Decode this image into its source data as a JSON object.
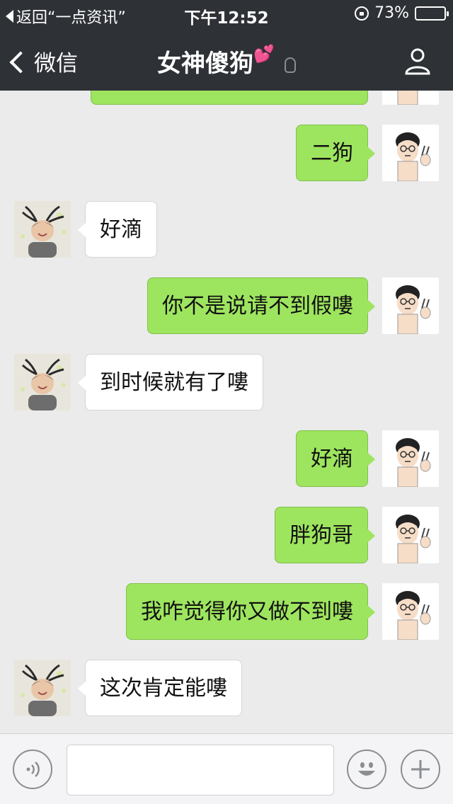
{
  "status_bar": {
    "back_app": "返回“一点资讯”",
    "time": "下午12:52",
    "battery_percent": "73%",
    "battery_level": 0.73,
    "battery_color": "#f5c400"
  },
  "nav": {
    "back_label": "微信",
    "title": "女神傻狗",
    "title_emoji": "💕",
    "ear_icon": "ear-icon",
    "profile_icon": "person-icon"
  },
  "messages": [
    {
      "side": "me",
      "text": "二狗"
    },
    {
      "side": "other",
      "text": "好滴"
    },
    {
      "side": "me",
      "text": "你不是说请不到假嘍"
    },
    {
      "side": "other",
      "text": "到时候就有了嘍"
    },
    {
      "side": "me",
      "text": "好滴"
    },
    {
      "side": "me",
      "text": "胖狗哥"
    },
    {
      "side": "me",
      "text": "我咋觉得你又做不到嘍"
    },
    {
      "side": "other",
      "text": "这次肯定能嘍"
    }
  ],
  "input_bar": {
    "voice_icon": "voice-icon",
    "emoji_icon": "smiley-icon",
    "add_icon": "plus-icon",
    "text_value": ""
  },
  "colors": {
    "nav_bg": "#2e3136",
    "my_bubble": "#9ee55f",
    "other_bubble": "#ffffff",
    "chat_bg": "#ebebeb"
  }
}
